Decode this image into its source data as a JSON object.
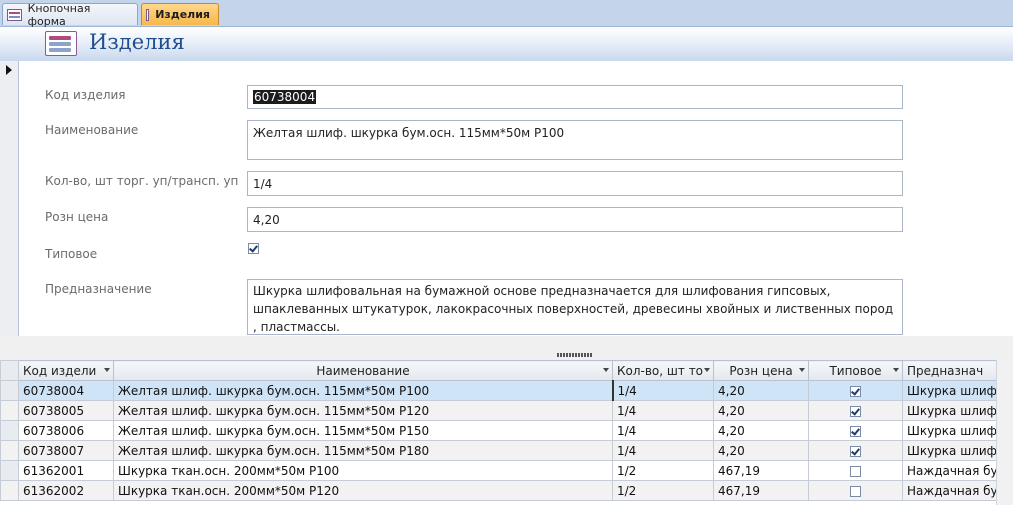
{
  "tabs": [
    {
      "label": "Кнопочная форма",
      "active": false
    },
    {
      "label": "Изделия",
      "active": true
    }
  ],
  "form": {
    "title": "Изделия",
    "fields": {
      "code": {
        "label": "Код изделия",
        "value": "60738004"
      },
      "name": {
        "label": "Наименование",
        "value": "Желтая шлиф. шкурка  бум.осн. 115мм*50м Р100"
      },
      "qty": {
        "label": "Кол-во, шт торг. уп/трансп. уп",
        "value": "1/4"
      },
      "price": {
        "label": "Розн цена",
        "value": "4,20"
      },
      "standard": {
        "label": "Типовое",
        "checked": true
      },
      "purpose": {
        "label": "Предназначение",
        "value": "Шкурка шлифовальная на бумажной основе предназначается для шлифования гипсовых, шпаклеванных штукатурок, лакокрасочных поверхностей, древесины хвойных и лиственных пород , пластмассы."
      }
    }
  },
  "grid": {
    "columns": [
      "Код издели",
      "Наименование",
      "Кол-во, шт то",
      "Розн цена",
      "Типовое",
      "Предназнач"
    ],
    "rows": [
      {
        "code": "60738004",
        "name": "Желтая шлиф. шкурка  бум.осн. 115мм*50м Р100",
        "qty": "1/4",
        "price": "4,20",
        "standard": true,
        "purpose": "Шкурка шлифо"
      },
      {
        "code": "60738005",
        "name": "Желтая шлиф. шкурка  бум.осн. 115мм*50м Р120",
        "qty": "1/4",
        "price": "4,20",
        "standard": true,
        "purpose": "Шкурка шлифо"
      },
      {
        "code": "60738006",
        "name": "Желтая шлиф. шкурка  бум.осн. 115мм*50м Р150",
        "qty": "1/4",
        "price": "4,20",
        "standard": true,
        "purpose": "Шкурка шлифо"
      },
      {
        "code": "60738007",
        "name": "Желтая шлиф. шкурка  бум.осн. 115мм*50м Р180",
        "qty": "1/4",
        "price": "4,20",
        "standard": true,
        "purpose": "Шкурка шлифо"
      },
      {
        "code": "61362001",
        "name": "Шкурка  ткан.осн. 200мм*50м Р100",
        "qty": "1/2",
        "price": "467,19",
        "standard": false,
        "purpose": "Наждачная бу"
      },
      {
        "code": "61362002",
        "name": "Шкурка  ткан.осн. 200мм*50м Р120",
        "qty": "1/2",
        "price": "467,19",
        "standard": false,
        "purpose": "Наждачная бу"
      }
    ]
  }
}
